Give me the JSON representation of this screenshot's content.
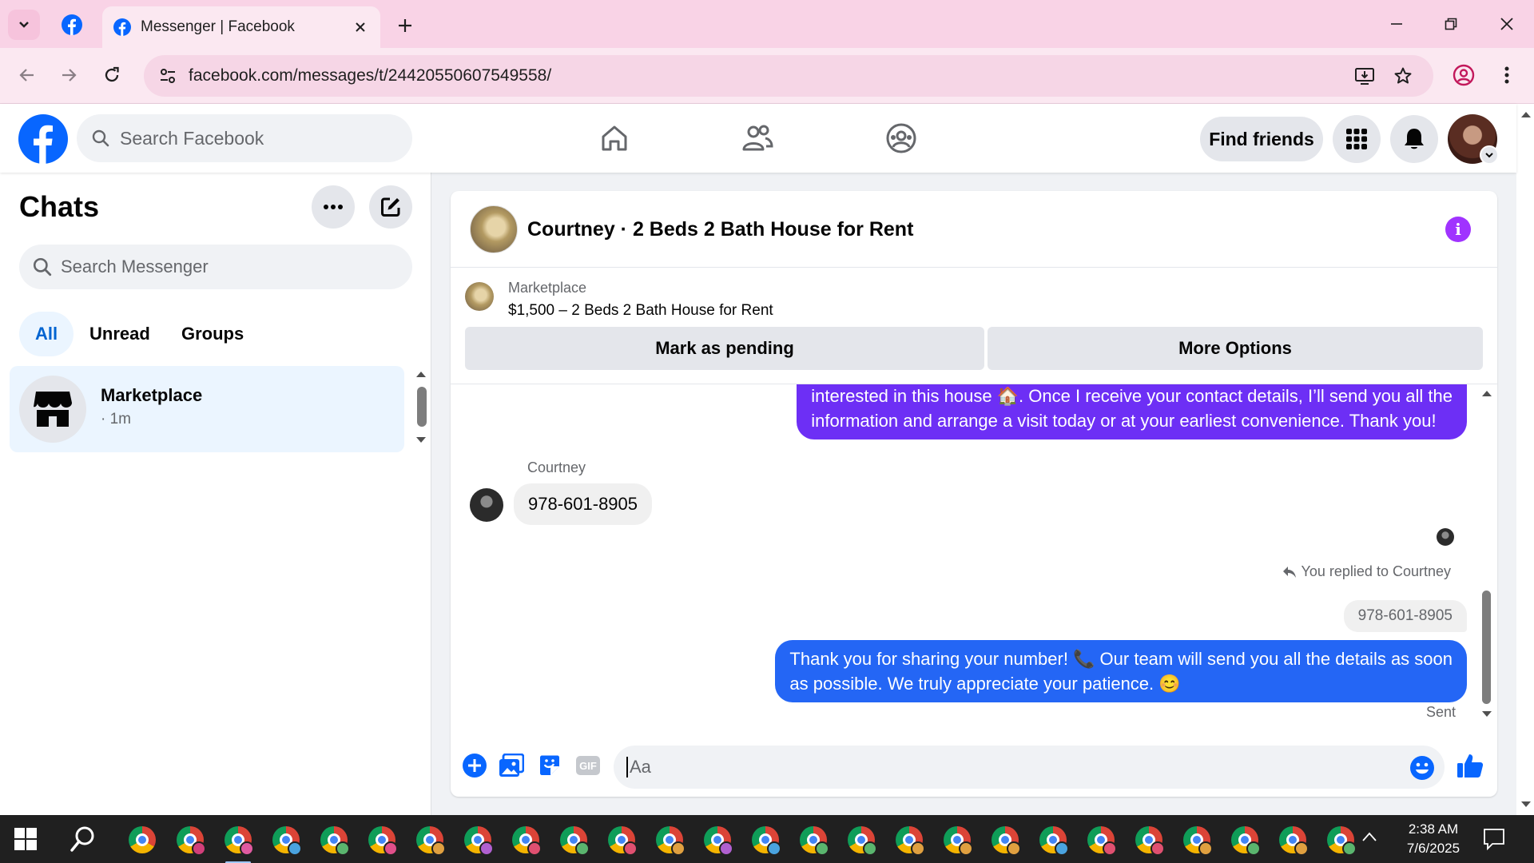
{
  "browser": {
    "tab_title": "Messenger | Facebook",
    "url": "facebook.com/messages/t/24420550607549558/"
  },
  "header": {
    "search_placeholder": "Search Facebook",
    "find_friends": "Find friends"
  },
  "sidebar": {
    "title": "Chats",
    "search_placeholder": "Search Messenger",
    "filters": [
      "All",
      "Unread",
      "Groups"
    ],
    "active_filter": "All",
    "chats": [
      {
        "name": "Marketplace",
        "meta": "· 1m"
      }
    ]
  },
  "conversation": {
    "title": "Courtney · 2 Beds 2 Bath House for Rent",
    "listing": {
      "label": "Marketplace",
      "price_title": "$1,500 – 2 Beds 2 Bath House for Rent",
      "mark_pending": "Mark as pending",
      "more_options": "More Options"
    },
    "messages": {
      "outgoing_1_line1": "interested in this house 🏠. Once I receive your contact details, I’ll send you all the",
      "outgoing_1_line2": "information and arrange a visit today or at your earliest convenience. Thank you!",
      "incoming_sender": "Courtney",
      "incoming_text": "978-601-8905",
      "replied_label": "You replied to Courtney",
      "quoted_text": "978-601-8905",
      "outgoing_2_line1": "Thank you for sharing your number! 📞 Our team will send you all the details as soon",
      "outgoing_2_line2": "as possible. We truly appreciate your patience. 😊",
      "status": "Sent"
    },
    "composer_placeholder": "Aa"
  },
  "taskbar": {
    "time": "2:38 AM",
    "date": "7/6/2025",
    "profile_badge_colors": [
      "",
      "#d23f7a",
      "#e05aa0",
      "#4aa3df",
      "#5ab56e",
      "#e04f8a",
      "#e0a040",
      "#b060d0",
      "#e05070",
      "#5ab56e",
      "#e05070",
      "#e0a040",
      "#b060d0",
      "#4aa3df",
      "#5ab56e",
      "#5ab56e",
      "#e0a040",
      "#e0a040",
      "#e0a040",
      "#4aa3df",
      "#e05070",
      "#e05070",
      "#e0a040",
      "#5ab56e",
      "#e0a040",
      "#5ab56e"
    ]
  },
  "colors": {
    "fb_blue": "#0866ff",
    "outgoing_purple": "#6d2ff5",
    "outgoing_blue": "#2466f5",
    "info_purple": "#a033ff"
  }
}
